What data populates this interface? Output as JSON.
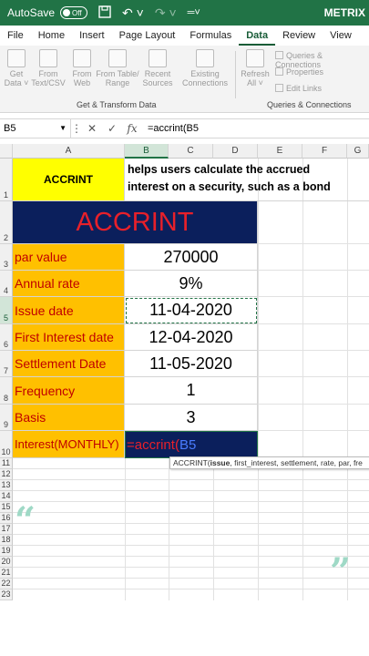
{
  "titlebar": {
    "autosave": "AutoSave",
    "toggle": "Off",
    "title": "METRIX"
  },
  "menu": [
    "File",
    "Home",
    "Insert",
    "Page Layout",
    "Formulas",
    "Data",
    "Review",
    "View"
  ],
  "ribbon": {
    "buttons": [
      {
        "line1": "Get",
        "line2": "Data ˅"
      },
      {
        "line1": "From",
        "line2": "Text/CSV"
      },
      {
        "line1": "From",
        "line2": "Web"
      },
      {
        "line1": "From Table/",
        "line2": "Range"
      },
      {
        "line1": "Recent",
        "line2": "Sources"
      },
      {
        "line1": "Existing",
        "line2": "Connections"
      },
      {
        "line1": "Refresh",
        "line2": "All ˅"
      }
    ],
    "small": [
      "Queries & Connections",
      "Properties",
      "Edit Links"
    ],
    "group1": "Get & Transform Data",
    "group2": "Queries & Connections"
  },
  "formula_bar": {
    "name_box": "B5",
    "formula": "=accrint(B5"
  },
  "columns": [
    "A",
    "B",
    "C",
    "D",
    "E",
    "F",
    "G"
  ],
  "rows": [
    "1",
    "2",
    "3",
    "4",
    "5",
    "6",
    "7",
    "8",
    "9",
    "10",
    "11",
    "12",
    "13",
    "14",
    "15",
    "16",
    "17",
    "18",
    "19",
    "20",
    "21",
    "22",
    "23"
  ],
  "sheet": {
    "a1": "ACCRINT",
    "b1_line1": "helps users calculate the accrued",
    "b1_line2": "interest on a security, such as a bond",
    "title": "ACCRINT",
    "labels": [
      "par value",
      "Annual rate",
      "Issue date",
      "First Interest date",
      "Settlement Date",
      "Frequency",
      "Basis"
    ],
    "values": [
      "270000",
      "9%",
      "11-04-2020",
      "12-04-2020",
      "11-05-2020",
      "1",
      "3"
    ],
    "a10": "Interest(MONTHLY)",
    "b10_func": "=accrint(",
    "b10_ref": "B5"
  },
  "tooltip": {
    "func": "ACCRINT(",
    "arg1": "issue",
    "rest": ", first_interest, settlement, rate, par, fre"
  },
  "colors": {
    "excel_green": "#217346",
    "navy": "#0b1f5c",
    "label_red": "#c00000",
    "ref_blue": "#4a7cff"
  }
}
